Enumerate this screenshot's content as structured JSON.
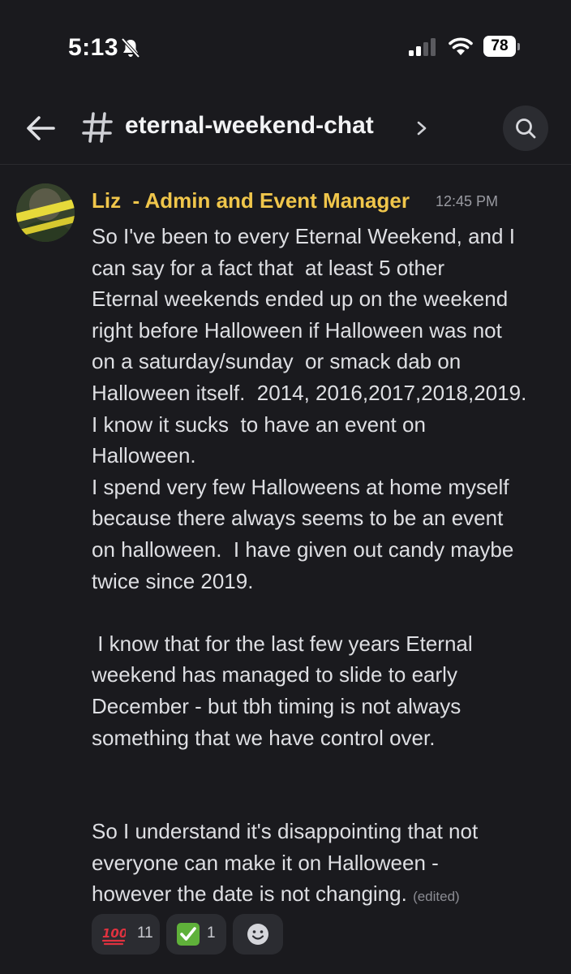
{
  "status_bar": {
    "time": "5:13",
    "battery": "78"
  },
  "header": {
    "channel_hash": "#",
    "channel_name": "eternal-weekend-chat"
  },
  "message": {
    "author": "Liz  - Admin and Event Manager",
    "author_color": "#f0c64b",
    "timestamp": "12:45 PM",
    "lines": [
      "So I've been to every Eternal Weekend, and I",
      "can say for a fact that  at least 5 other",
      "Eternal weekends ended up on the weekend",
      "right before Halloween if Halloween was not",
      "on a saturday/sunday  or smack dab on",
      "Halloween itself.  2014, 2016,2017,2018,2019.",
      "I know it sucks  to have an event on",
      "Halloween.",
      "I spend very few Halloweens at home myself",
      "because there always seems to be an event",
      "on halloween.  I have given out candy maybe",
      "twice since 2019.",
      "",
      " I know that for the last few years Eternal",
      "weekend has managed to slide to early",
      "December - but tbh timing is not always",
      "something that we have control over.",
      "",
      "",
      "So I understand it's disappointing that not",
      "everyone can make it on Halloween -",
      "however the date is not changing."
    ],
    "edited_label": "(edited)",
    "reactions": [
      {
        "emoji": "hundred-points-icon",
        "count": "11"
      },
      {
        "emoji": "check-mark-button-icon",
        "count": "1"
      },
      {
        "emoji": "add-reaction-icon"
      }
    ]
  }
}
